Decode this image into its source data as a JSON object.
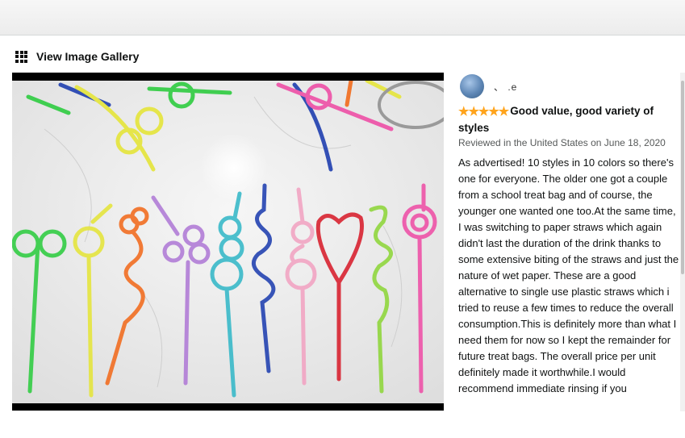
{
  "gallery": {
    "label": "View Image Gallery"
  },
  "review": {
    "reviewer_name": "、            .e",
    "stars": "★★★★★",
    "rating": 5,
    "title": "Good value, good variety of styles",
    "date": "Reviewed in the United States on June 18, 2020",
    "body": "As advertised! 10 styles in 10 colors so there's one for everyone. The older one got a couple from a school treat bag and of course, the younger one wanted one too.At the same time, I was switching to paper straws which again didn't last the duration of the drink thanks to some extensive biting of the straws and just the nature of wet paper. These are a good alternative to single use plastic straws which i tried to reuse a few times to reduce the overall consumption.This is definitely more than what I need them for now so I kept the remainder for future treat bags. The overall price per unit definitely made it worthwhile.I would recommend immediate rinsing if you"
  },
  "colors": {
    "star": "#ffa41c",
    "photo_bg": "#000000",
    "straw_green": "#2ecc40",
    "straw_yellow": "#e5e53a",
    "straw_orange": "#f26b1d",
    "straw_purple": "#b07ad6",
    "straw_teal": "#35b8c8",
    "straw_blue": "#1f3fb0",
    "straw_pink": "#f2a3c2",
    "straw_red": "#d81e2c",
    "straw_lime": "#8ed63a",
    "straw_magenta": "#ee4fa6"
  }
}
